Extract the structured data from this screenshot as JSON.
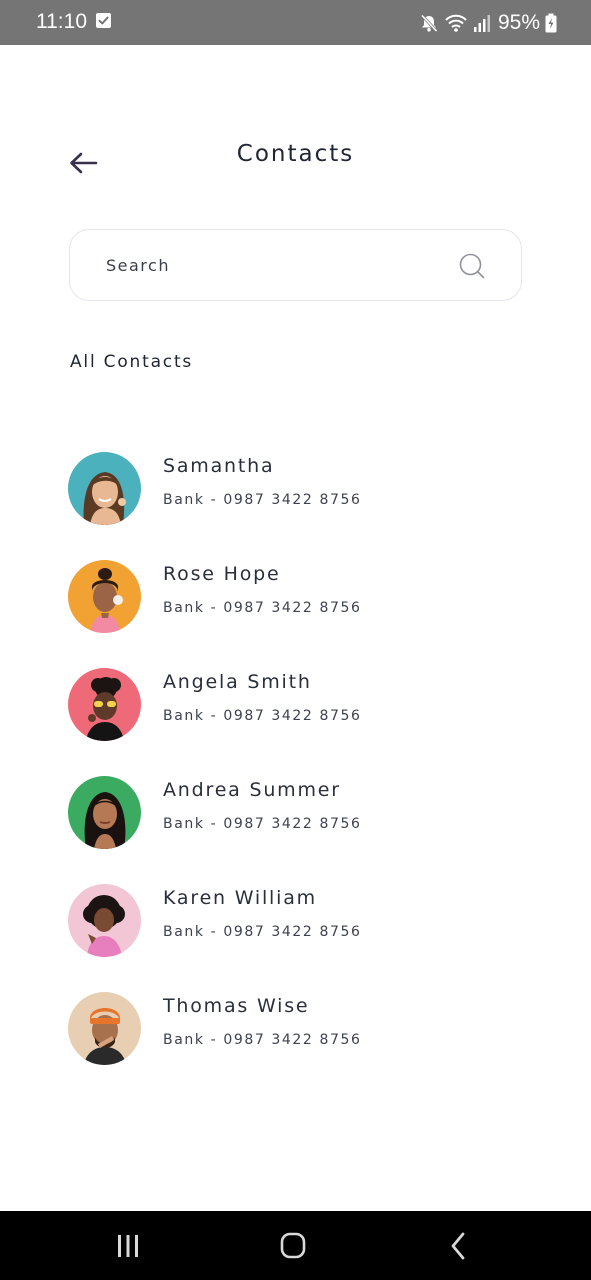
{
  "status_bar": {
    "time": "11:10",
    "battery_percent": "95%",
    "icons": [
      "checkbox-notification-icon",
      "mute-icon",
      "wifi-icon",
      "signal-icon",
      "battery-charging-icon"
    ]
  },
  "header": {
    "title": "Contacts",
    "back_icon": "arrow-left-icon"
  },
  "search": {
    "placeholder": "Search",
    "value": "",
    "icon": "search-icon"
  },
  "section": {
    "label": "All Contacts"
  },
  "contacts": [
    {
      "name": "Samantha",
      "detail": "Bank - 0987 3422 8756",
      "avatar_bg": "#4bb1bd"
    },
    {
      "name": "Rose Hope",
      "detail": "Bank - 0987 3422 8756",
      "avatar_bg": "#f2a133"
    },
    {
      "name": "Angela Smith",
      "detail": "Bank - 0987 3422 8756",
      "avatar_bg": "#ef6a78"
    },
    {
      "name": "Andrea Summer",
      "detail": "Bank - 0987 3422 8756",
      "avatar_bg": "#3bab62"
    },
    {
      "name": "Karen William",
      "detail": "Bank - 0987 3422 8756",
      "avatar_bg": "#f2c6d4"
    },
    {
      "name": "Thomas Wise",
      "detail": "Bank - 0987 3422 8756",
      "avatar_bg": "#e8cfb4"
    }
  ],
  "nav_bar": {
    "buttons": [
      "recent-apps-icon",
      "home-icon",
      "back-icon"
    ]
  },
  "colors": {
    "status_bar": "#757575",
    "text_primary": "#1f2533",
    "search_border": "#e4e6ee",
    "nav_bar": "#000000"
  }
}
